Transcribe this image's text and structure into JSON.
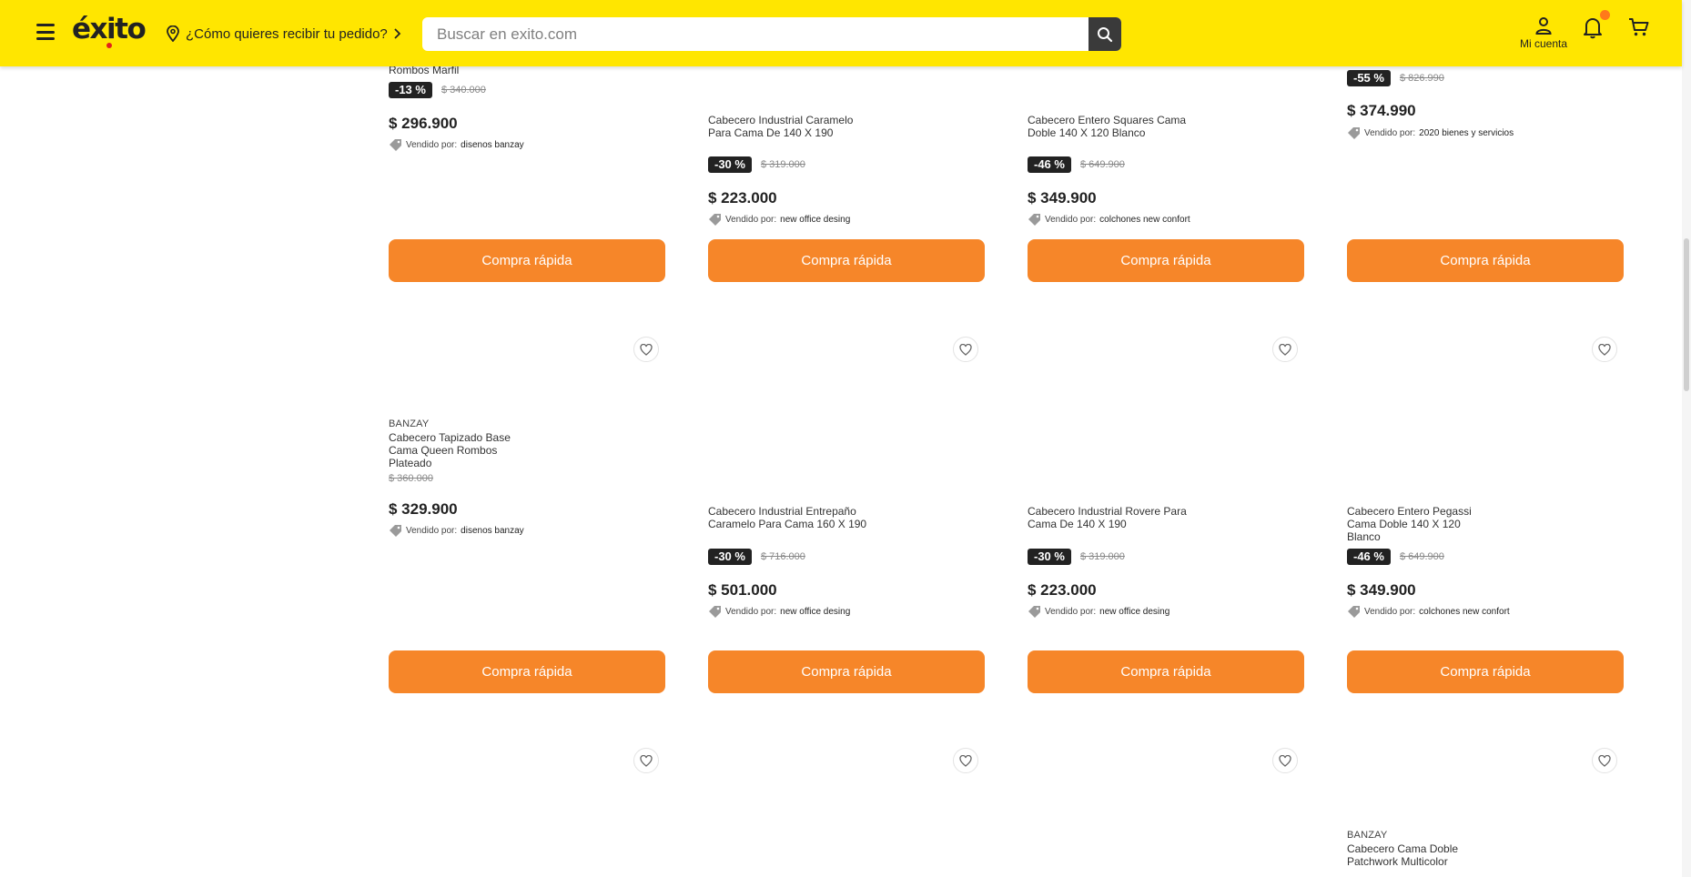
{
  "header": {
    "logo_text": "éxito",
    "location_text": "¿Cómo quieres recibir tu pedido?",
    "search_placeholder": "Buscar en exito.com",
    "account_label": "Mi cuenta"
  },
  "colors": {
    "header_bg": "#ffe600",
    "buy_button": "#f68629",
    "badge_bg": "#222222"
  },
  "products": [
    {
      "brand": "",
      "title": "Rombos Marfil",
      "discount": "-13 %",
      "old_price": "$ 340.000",
      "price": "$ 296.900",
      "seller_label": "Vendido por:",
      "seller": "disenos banzay",
      "button": "Compra rápida"
    },
    {
      "brand": "",
      "title": "Cabecero Industrial Caramelo Para Cama De 140 X 190",
      "discount": "-30 %",
      "old_price": "$ 319.000",
      "price": "$ 223.000",
      "seller_label": "Vendido por:",
      "seller": "new office desing",
      "button": "Compra rápida"
    },
    {
      "brand": "",
      "title": "Cabecero Entero Squares Cama Doble 140 X 120 Blanco",
      "discount": "-46 %",
      "old_price": "$ 649.900",
      "price": "$ 349.900",
      "seller_label": "Vendido por:",
      "seller": "colchones new confort",
      "button": "Compra rápida"
    },
    {
      "brand": "",
      "title": "",
      "discount": "-55 %",
      "old_price": "$ 826.990",
      "price": "$ 374.990",
      "seller_label": "Vendido por:",
      "seller": "2020 bienes y servicios",
      "button": "Compra rápida"
    },
    {
      "brand": "BANZAY",
      "title": "Cabecero Tapizado Base Cama Queen Rombos Plateado",
      "discount": "",
      "old_price": "$ 360.000",
      "price": "$ 329.900",
      "seller_label": "Vendido por:",
      "seller": "disenos banzay",
      "button": "Compra rápida"
    },
    {
      "brand": "",
      "title": "Cabecero Industrial Entrepaño Caramelo Para Cama 160 X 190",
      "discount": "-30 %",
      "old_price": "$ 716.000",
      "price": "$ 501.000",
      "seller_label": "Vendido por:",
      "seller": "new office desing",
      "button": "Compra rápida"
    },
    {
      "brand": "",
      "title": "Cabecero Industrial Rovere Para Cama De 140 X 190",
      "discount": "-30 %",
      "old_price": "$ 319.000",
      "price": "$ 223.000",
      "seller_label": "Vendido por:",
      "seller": "new office desing",
      "button": "Compra rápida"
    },
    {
      "brand": "",
      "title": "Cabecero Entero Pegassi Cama Doble 140 X 120 Blanco",
      "discount": "-46 %",
      "old_price": "$ 649.900",
      "price": "$ 349.900",
      "seller_label": "Vendido por:",
      "seller": "colchones new confort",
      "button": "Compra rápida"
    },
    {
      "brand": "BANZAY",
      "title": "Cabecero Cama Doble Patchwork Multicolor"
    }
  ]
}
